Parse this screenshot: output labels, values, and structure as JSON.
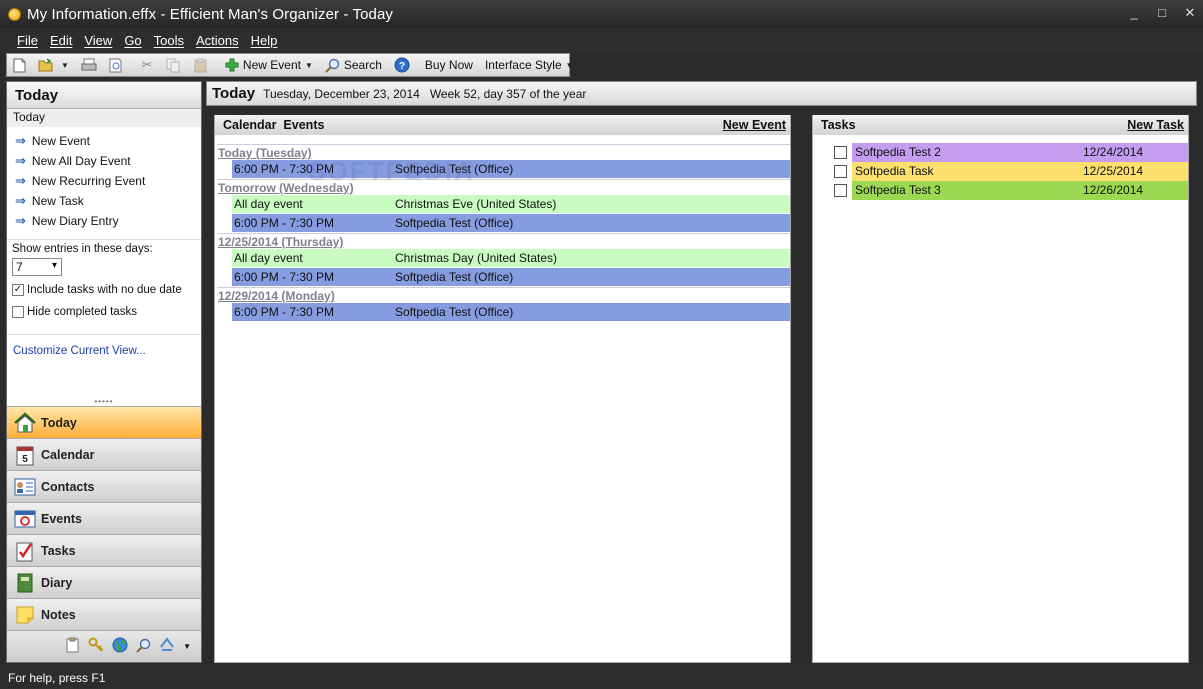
{
  "window": {
    "title": "My Information.effx - Efficient Man's Organizer - Today",
    "minimize": "_",
    "maximize": "□",
    "close": "✕"
  },
  "menu": [
    "File",
    "Edit",
    "View",
    "Go",
    "Tools",
    "Actions",
    "Help"
  ],
  "toolbar": {
    "new_event": "New Event",
    "search": "Search",
    "buy_now": "Buy Now",
    "interface_style": "Interface Style"
  },
  "left": {
    "header": "Today",
    "subheader": "Today",
    "actions": [
      "New Event",
      "New All Day Event",
      "New Recurring Event",
      "New Task",
      "New Diary Entry"
    ],
    "show_label": "Show entries in these days:",
    "days_value": "7",
    "include_no_due": "Include tasks with no due date",
    "include_no_due_checked": true,
    "hide_completed": "Hide completed tasks",
    "hide_completed_checked": false,
    "customize": "Customize Current View...",
    "nav": [
      "Today",
      "Calendar",
      "Contacts",
      "Events",
      "Tasks",
      "Diary",
      "Notes"
    ],
    "active_nav": "Today"
  },
  "main": {
    "title": "Today",
    "date_info": "Tuesday, December 23, 2014   Week 52, day 357 of the year"
  },
  "calendar": {
    "header": "Calendar  Events",
    "new_event": "New Event",
    "days": [
      {
        "label": "Today (Tuesday)",
        "events": [
          {
            "time": "6:00 PM - 7:30 PM",
            "title": "Softpedia Test (Office)",
            "kind": "timed"
          }
        ]
      },
      {
        "label": "Tomorrow (Wednesday)",
        "events": [
          {
            "time": "All day event",
            "title": "Christmas Eve (United States)",
            "kind": "allday"
          },
          {
            "time": "6:00 PM - 7:30 PM",
            "title": "Softpedia Test (Office)",
            "kind": "timed"
          }
        ]
      },
      {
        "label": "12/25/2014 (Thursday)",
        "events": [
          {
            "time": "All day event",
            "title": "Christmas Day (United States)",
            "kind": "allday"
          },
          {
            "time": "6:00 PM - 7:30 PM",
            "title": "Softpedia Test (Office)",
            "kind": "timed"
          }
        ]
      },
      {
        "label": "12/29/2014 (Monday)",
        "events": [
          {
            "time": "6:00 PM - 7:30 PM",
            "title": "Softpedia Test (Office)",
            "kind": "timed"
          }
        ]
      }
    ]
  },
  "tasks": {
    "header": "Tasks",
    "new_task": "New Task",
    "items": [
      {
        "name": "Softpedia Test 2",
        "date": "12/24/2014",
        "color": "#c49cf0"
      },
      {
        "name": "Softpedia Task",
        "date": "12/25/2014",
        "color": "#fbe06e"
      },
      {
        "name": "Softpedia Test 3",
        "date": "12/26/2014",
        "color": "#9cd852"
      }
    ]
  },
  "status": "For help, press F1",
  "watermark": "SOFTPEDIA"
}
